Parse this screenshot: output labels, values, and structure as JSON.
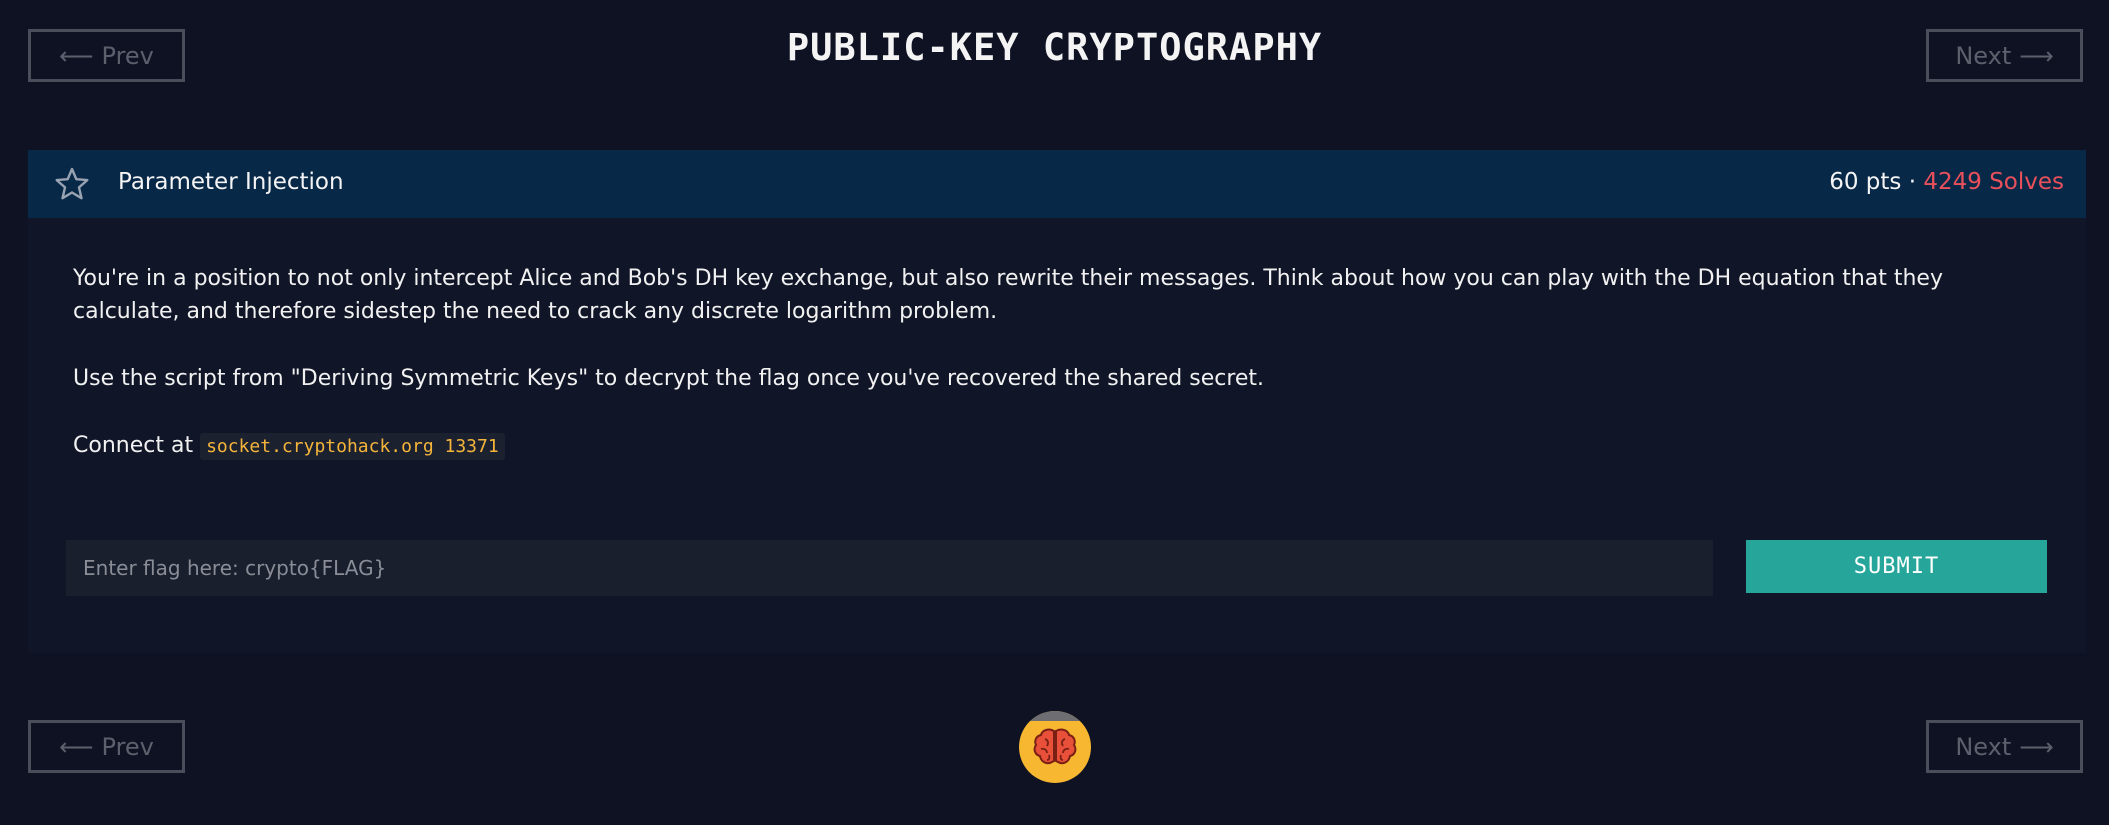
{
  "nav": {
    "prev_label": "Prev",
    "next_label": "Next",
    "prev_arrow": "⟵",
    "next_arrow": "⟶"
  },
  "page": {
    "title": "PUBLIC-KEY CRYPTOGRAPHY"
  },
  "challenge": {
    "name": "Parameter Injection",
    "points": "60 pts",
    "separator": "·",
    "solves": "4249 Solves",
    "description": [
      "You're in a position to not only intercept Alice and Bob's DH key exchange, but also rewrite their messages. Think about how you can play with the DH equation that they calculate, and therefore sidestep the need to crack any discrete logarithm problem.",
      "Use the script from \"Deriving Symmetric Keys\" to decrypt the flag once you've recovered the shared secret."
    ],
    "connect_prefix": "Connect at",
    "connect_address": "socket.cryptohack.org 13371"
  },
  "form": {
    "flag_placeholder": "Enter flag here: crypto{FLAG}",
    "submit_label": "SUBMIT"
  },
  "icons": {
    "star": "star-icon",
    "avatar": "brain-icon"
  },
  "colors": {
    "background": "#0e1223",
    "header": "#082848",
    "solves": "#e8505b",
    "code": "#f5b53a",
    "submit": "#26a69a",
    "avatar": "#f7b731"
  }
}
